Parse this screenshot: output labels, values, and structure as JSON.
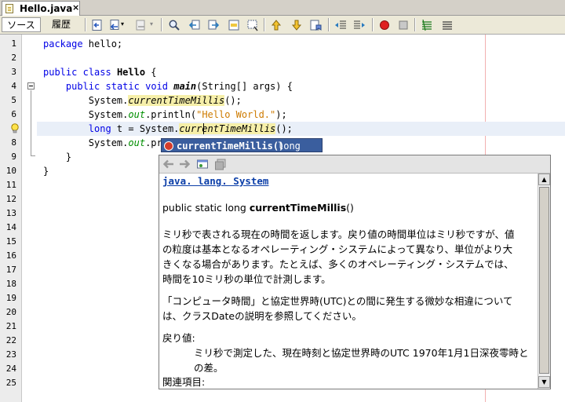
{
  "tab": {
    "title": "Hello.java",
    "close_glyph": "×"
  },
  "toolbar": {
    "source_label": "ソース",
    "history_label": "履歴"
  },
  "line_numbers": [
    "1",
    "2",
    "3",
    "4",
    "5",
    "6",
    "7",
    "8",
    "9",
    "10",
    "11",
    "12",
    "13",
    "14",
    "15",
    "16",
    "17",
    "18",
    "19",
    "20",
    "21",
    "22",
    "23",
    "24",
    "25"
  ],
  "code": {
    "l1": {
      "kw": "package",
      "rest": " hello;"
    },
    "l3": {
      "kw1": "public",
      "kw2": "class",
      "name": "Hello",
      "rest": " {"
    },
    "l4": {
      "kw1": "public",
      "kw2": "static",
      "kw3": "void",
      "name": "main",
      "rest": "(String[] args) {"
    },
    "l5": {
      "pre": "System.",
      "method": "currentTimeMillis",
      "rest": "();"
    },
    "l6": {
      "pre": "System.",
      "field": "out",
      "mid": ".println(",
      "str": "\"Hello World.\"",
      "rest": ");"
    },
    "l7": {
      "kw": "long",
      "pre": " t = System.",
      "method": "currentTimeMillis",
      "rest": "();"
    },
    "l8": {
      "pre": "System.",
      "field": "out",
      "rest": ".pr"
    },
    "l9": "}",
    "l10": "}"
  },
  "completion": {
    "method": "currentTimeMillis()",
    "type": "long"
  },
  "javadoc": {
    "class_link": "java. lang. System",
    "signature_prefix": "public static long ",
    "signature_name": "currentTimeMillis",
    "signature_suffix": "()",
    "desc_lines": [
      "ミリ秒で表される現在の時間を返します。戻り値の時間単位はミリ秒ですが、値",
      "の粒度は基本となるオペレーティング・システムによって異なり、単位がより大",
      "きくなる場合があります。たとえば、多くのオペレーティング・システムでは、",
      "時間を10ミリ秒の単位で計測します。"
    ],
    "para2_lines": [
      "「コンピュータ時間」と協定世界時(UTC)との間に発生する微妙な相違について",
      "は、クラスDateの説明を参照してください。"
    ],
    "returns_label": "戻り値:",
    "returns_lines": [
      "ミリ秒で測定した、現在時刻と協定世界時のUTC 1970年1月1日深夜零時と",
      "の差。"
    ],
    "see_also_label": "関連項目:"
  },
  "colors": {
    "keyword": "#0000e6",
    "static_field": "#008f00",
    "string": "#ce7b00",
    "selection": "#3a5e9e",
    "link": "#0b3ea8"
  }
}
